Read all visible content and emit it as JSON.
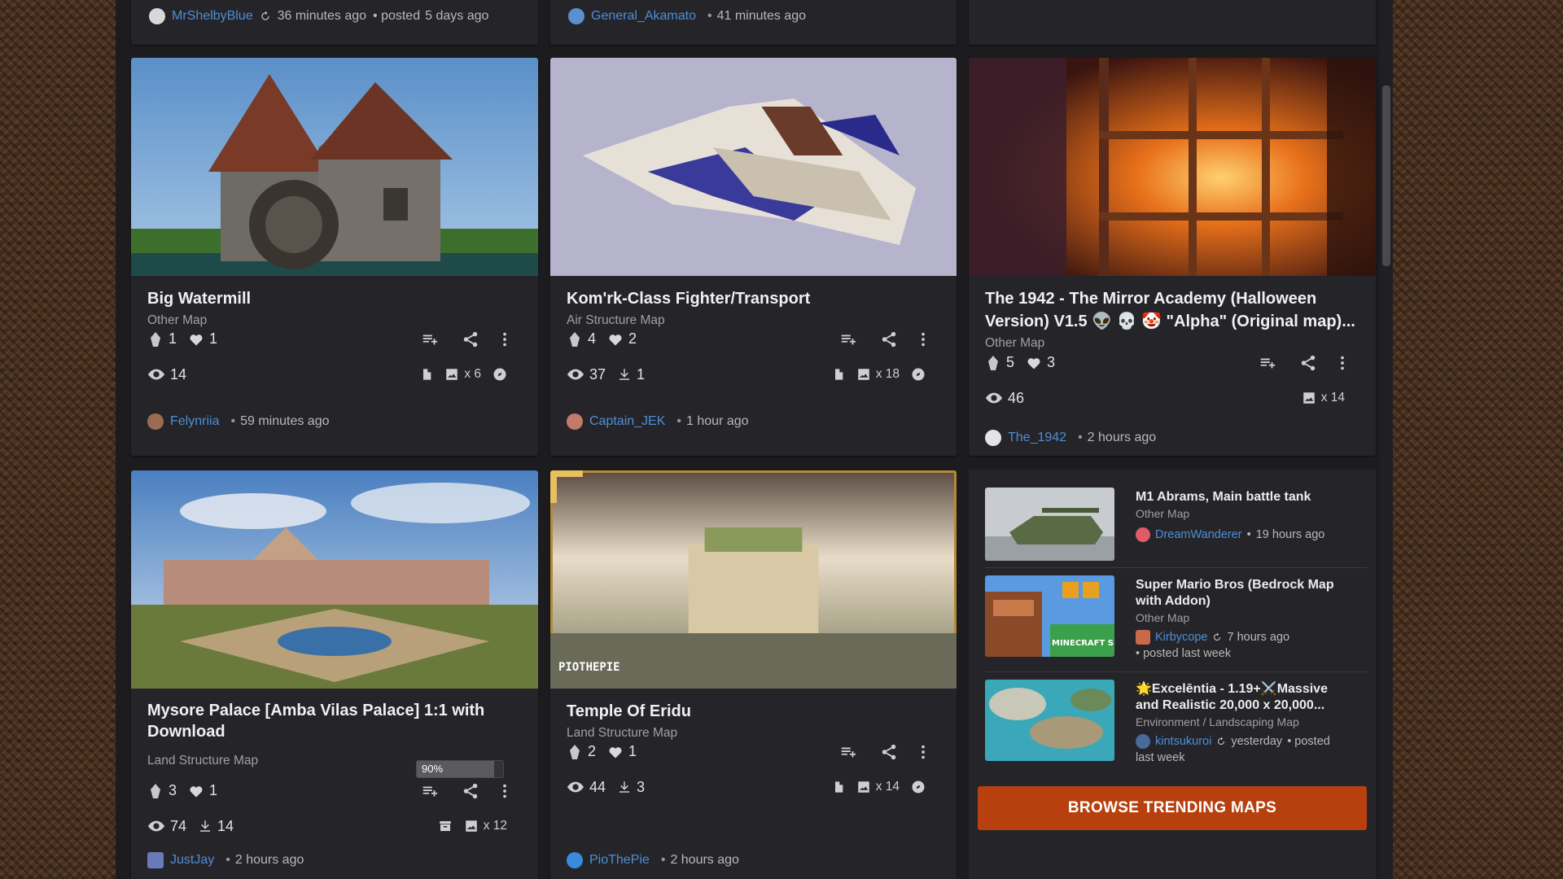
{
  "top_row": [
    {
      "author": "MrShelbyBlue",
      "time": "36 minutes ago",
      "extra": "• posted",
      "extra2": "5 days ago"
    },
    {
      "author": "General_Akamato",
      "time": "41 minutes ago"
    }
  ],
  "cards": [
    {
      "title": "Big Watermill",
      "category": "Other Map",
      "diamonds": "1",
      "hearts": "1",
      "views": "14",
      "images": "x 6",
      "author": "Felynriia",
      "time": "59 minutes ago"
    },
    {
      "title": "Kom'rk-Class Fighter/Transport",
      "category": "Air Structure Map",
      "diamonds": "4",
      "hearts": "2",
      "views": "37",
      "downloads": "1",
      "images": "x 18",
      "author": "Captain_JEK",
      "time": "1 hour ago"
    },
    {
      "title_line1": "The 1942 - The Mirror Academy (Halloween",
      "title_line2": "Version) V1.5 👽 💀 🤡 \"Alpha\" (Original map)...",
      "category": "Other Map",
      "diamonds": "5",
      "hearts": "3",
      "views": "46",
      "images": "x 14",
      "author": "The_1942",
      "time": "2 hours ago"
    },
    {
      "title_line1": "Mysore Palace [Amba Vilas Palace] 1:1 with",
      "title_line2": "Download",
      "category": "Land Structure Map",
      "progress_label": "90%",
      "progress_value": 0.9,
      "diamonds": "3",
      "hearts": "1",
      "views": "74",
      "downloads": "14",
      "images": "x 12",
      "author": "JustJay",
      "time": "2 hours ago"
    },
    {
      "title": "Temple Of Eridu",
      "category": "Land Structure Map",
      "diamonds": "2",
      "hearts": "1",
      "views": "44",
      "downloads": "3",
      "images": "x 14",
      "author": "PioThePie",
      "time": "2 hours ago",
      "watermark": "PIOTHEPIE"
    }
  ],
  "side": [
    {
      "title": "M1 Abrams, Main battle tank",
      "category": "Other Map",
      "author": "DreamWanderer",
      "time": "19 hours ago"
    },
    {
      "title_line1": "Super Mario Bros (Bedrock Map",
      "title_line2": "with Addon)",
      "category": "Other Map",
      "author": "Kirbycope",
      "time": "7 hours ago",
      "extra": "• posted  last week",
      "thumb_text": "MINECRAFT SMB"
    },
    {
      "title_line1": "🌟Excelēntia - 1.19+⚔️Massive",
      "title_line2": "and Realistic 20,000 x 20,000...",
      "category": "Environment / Landscaping Map",
      "author": "kintsukuroi",
      "time": "yesterday",
      "extra": "• posted",
      "extra2": "last week"
    }
  ],
  "browse_button": "BROWSE TRENDING MAPS",
  "colors": {
    "accent": "#b7400e",
    "link": "#4d8ed6",
    "panel": "#1c1c1f",
    "card": "#252529"
  }
}
